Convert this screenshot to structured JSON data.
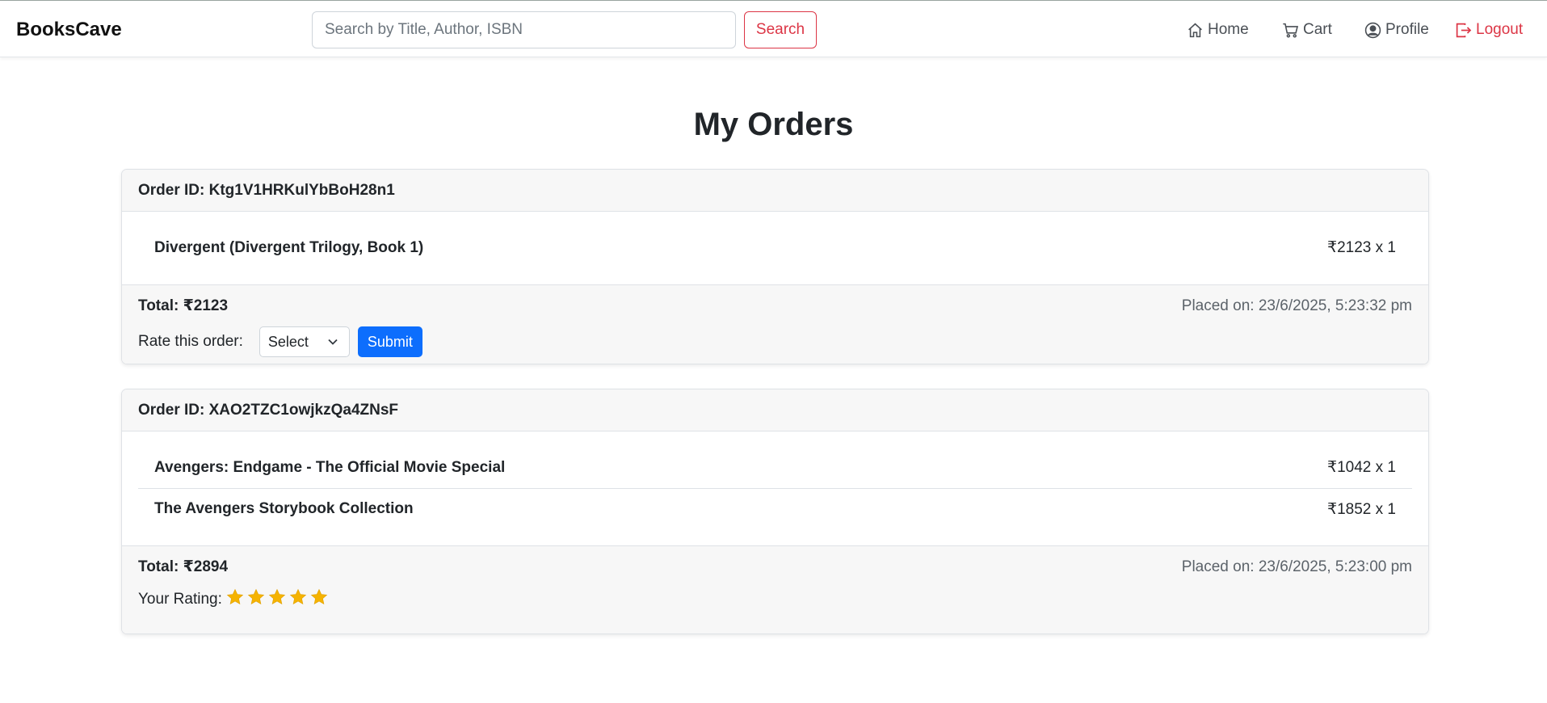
{
  "app": {
    "brand": "BooksCave"
  },
  "search": {
    "placeholder": "Search by Title, Author, ISBN",
    "button_label": "Search"
  },
  "nav": {
    "home": "Home",
    "cart": "Cart",
    "profile": "Profile",
    "logout": "Logout"
  },
  "page": {
    "title": "My Orders"
  },
  "orders": [
    {
      "id_text": "Order ID: Ktg1V1HRKulYbBoH28n1",
      "items": [
        {
          "title": "Divergent (Divergent Trilogy, Book 1)",
          "price": "₹2123 x 1"
        }
      ],
      "total": "Total: ₹2123",
      "placed": "Placed on: 23/6/2025, 5:23:32 pm",
      "rate_label": "Rate this order:",
      "select_value": "Select",
      "submit_label": "Submit"
    },
    {
      "id_text": "Order ID: XAO2TZC1owjkzQa4ZNsF",
      "items": [
        {
          "title": "Avengers: Endgame - The Official Movie Special",
          "price": "₹1042 x 1"
        },
        {
          "title": "The Avengers Storybook Collection",
          "price": "₹1852 x 1"
        }
      ],
      "total": "Total: ₹2894",
      "placed": "Placed on: 23/6/2025, 5:23:00 pm",
      "rating_label": "Your Rating:",
      "rating_value": 5,
      "rating_max": 5
    }
  ],
  "colors": {
    "accent_danger": "#dc3545",
    "accent_primary": "#0d6efd",
    "star": "#f5b301"
  }
}
